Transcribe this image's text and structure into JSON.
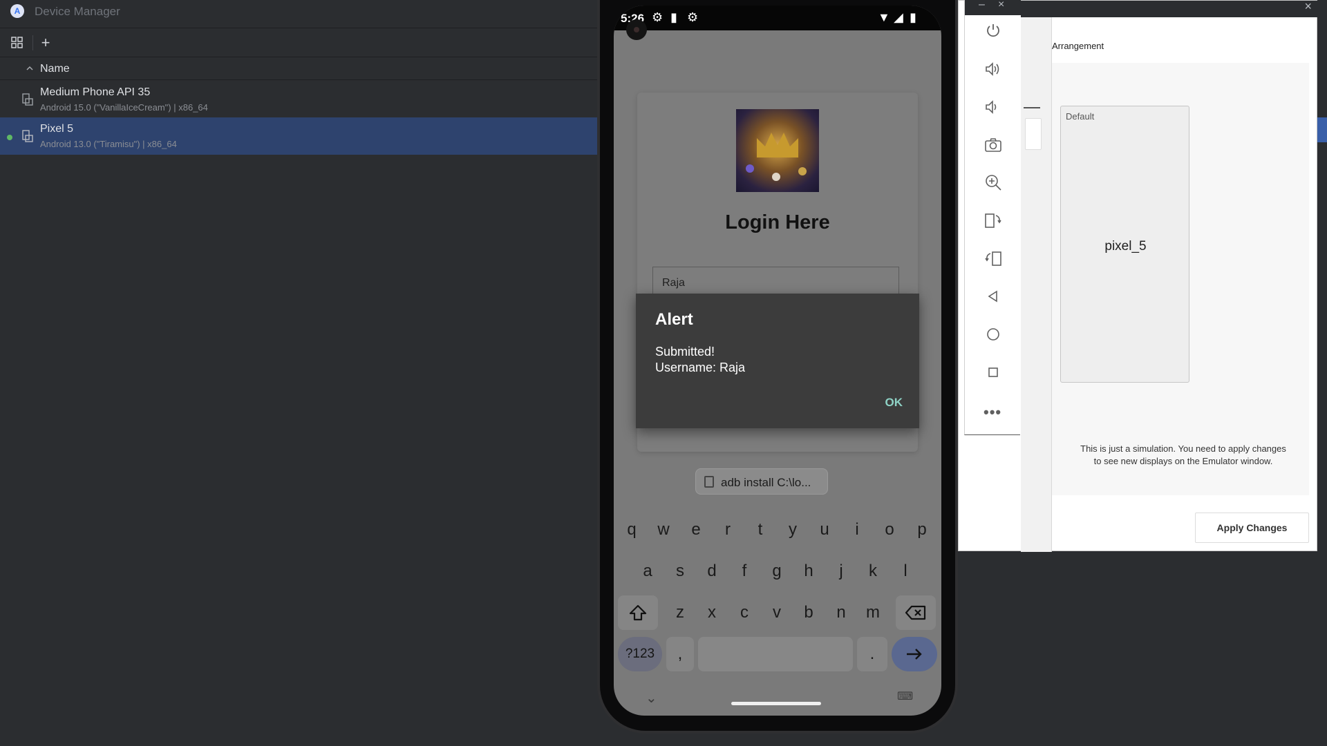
{
  "device_manager": {
    "title": "Device Manager",
    "app_icon": "android-studio-icon",
    "toolbar": {
      "device_mirror_icon": "device-grid-icon",
      "add_label": "+"
    },
    "column_header": "Name",
    "devices": [
      {
        "name": "Medium Phone API 35",
        "description": "Android 15.0 (\"VanillaIceCream\") | x86_64",
        "running": false,
        "selected": false
      },
      {
        "name": "Pixel 5",
        "description": "Android 13.0 (\"Tiramisu\") | x86_64",
        "running": true,
        "selected": true
      }
    ]
  },
  "emulator": {
    "status_time": "5:26",
    "login_title": "Login Here",
    "username_value": "Raja",
    "alert": {
      "title": "Alert",
      "message_line1": "Submitted!",
      "message_line2": "Username: Raja",
      "ok_label": "OK"
    },
    "clipboard_chip": "adb install C:\\lo...",
    "keyboard": {
      "row1": [
        "q",
        "w",
        "e",
        "r",
        "t",
        "y",
        "u",
        "i",
        "o",
        "p"
      ],
      "row2": [
        "a",
        "s",
        "d",
        "f",
        "g",
        "h",
        "j",
        "k",
        "l"
      ],
      "row3": [
        "z",
        "x",
        "c",
        "v",
        "b",
        "n",
        "m"
      ],
      "symbols_key": "?123",
      "comma_key": ",",
      "period_key": "."
    }
  },
  "side_toolbar": {
    "icons": [
      "power-icon",
      "volume-up-icon",
      "volume-down-icon",
      "camera-icon",
      "zoom-in-icon",
      "rotate-left-icon",
      "rotate-right-icon",
      "back-icon",
      "home-icon",
      "overview-icon",
      "more-icon"
    ],
    "minimize_label": "–",
    "close_label": "×"
  },
  "extended_controls": {
    "section_title": "Arrangement",
    "display_label": "Default",
    "display_name": "pixel_5",
    "note": "This is just a simulation. You need to apply changes to see new displays on the Emulator window.",
    "apply_label": "Apply Changes",
    "close_label": "×"
  },
  "colors": {
    "ide_background": "#2b2d30",
    "selection": "#2e436e",
    "running_dot": "#5fb865",
    "alert_ok": "#8fd3c6"
  }
}
